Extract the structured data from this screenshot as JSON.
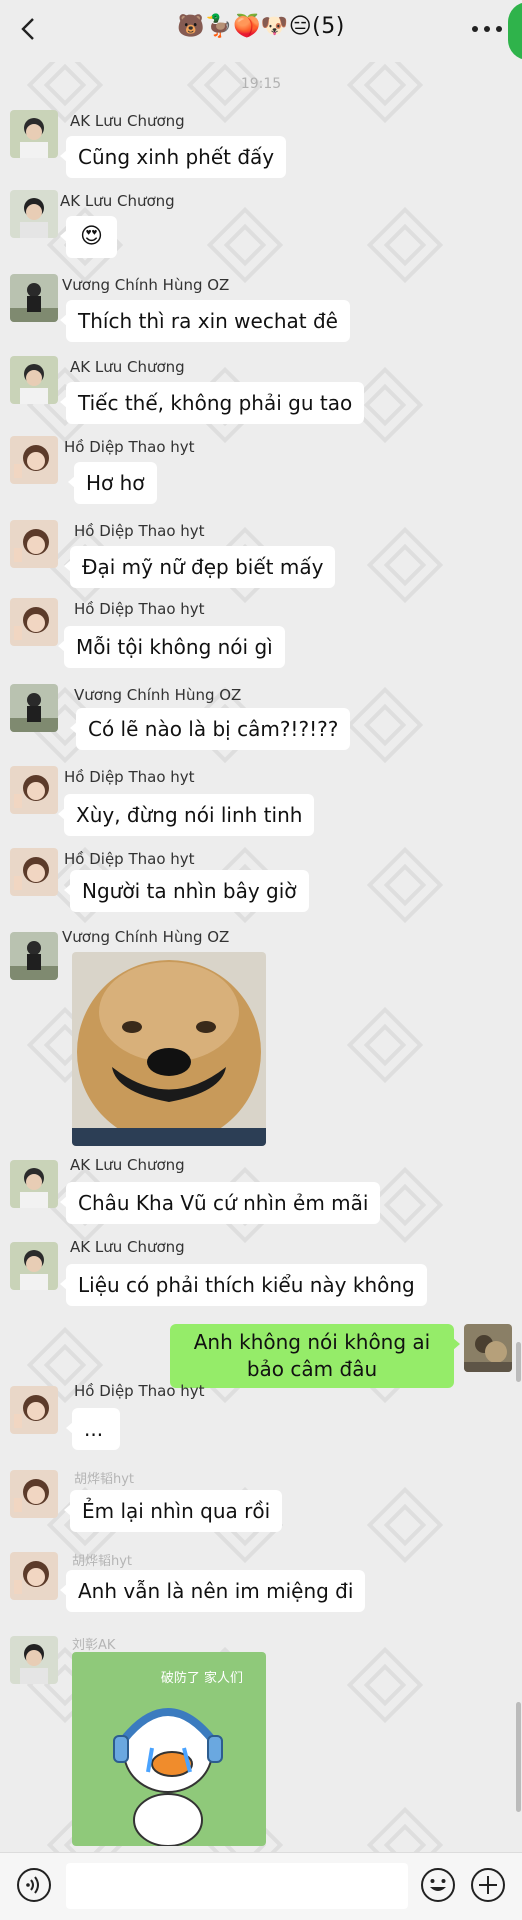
{
  "header": {
    "title": "🐻🦆🍑🐶😑(5)"
  },
  "time": "19:15",
  "messages": [
    {
      "sender": "AK Lưu Chương",
      "text": "Cũng xinh phết đấy"
    },
    {
      "sender": "AK Lưu Chương",
      "text": "😍"
    },
    {
      "sender": "Vương Chính Hùng OZ",
      "text": "Thích thì ra xin wechat đê"
    },
    {
      "sender": "AK Lưu Chương",
      "text": "Tiếc thế, không phải gu tao"
    },
    {
      "sender": "Hồ Diệp Thao hyt",
      "text": "Hơ hơ"
    },
    {
      "sender": "Hồ Diệp Thao hyt",
      "text": "Đại mỹ nữ đẹp biết mấy"
    },
    {
      "sender": "Hồ Diệp Thao hyt",
      "text": "Mỗi tội không nói gì"
    },
    {
      "sender": "Vương Chính Hùng OZ",
      "text": "Có lẽ nào là bị câm?!?!??"
    },
    {
      "sender": "Hồ Diệp Thao hyt",
      "text": "Xùy, đừng nói linh tinh"
    },
    {
      "sender": "Hồ Diệp Thao hyt",
      "text": "Người ta nhìn bây giờ"
    },
    {
      "sender": "Vương Chính Hùng OZ",
      "sticker": "smiling-dog-sticker"
    },
    {
      "sender": "AK Lưu Chương",
      "text": "Châu Kha Vũ cứ nhìn ẻm mãi"
    },
    {
      "sender": "AK Lưu Chương",
      "text": "Liệu có phải thích kiểu này không"
    },
    {
      "sender": "me",
      "text": "Anh không nói không ai bảo câm đâu"
    },
    {
      "sender": "Hồ Diệp Thao hyt",
      "text": "..."
    },
    {
      "sender": "胡烨韬hyt",
      "text": "Ẻm lại nhìn qua rồi"
    },
    {
      "sender": "胡烨韬hyt",
      "text": "Anh vẫn là nên im miệng đi"
    },
    {
      "sender": "刘彰AK",
      "sticker": "crying-duck-sticker",
      "sticker_caption": "破防了 家人们"
    }
  ],
  "icons": {
    "back": "chevron-left-icon",
    "more": "more-dots-icon",
    "voice": "voice-icon",
    "emoji": "emoji-icon",
    "plus": "plus-icon"
  },
  "colors": {
    "background": "#ededed",
    "my_bubble": "#95ec69",
    "their_bubble": "#ffffff"
  }
}
